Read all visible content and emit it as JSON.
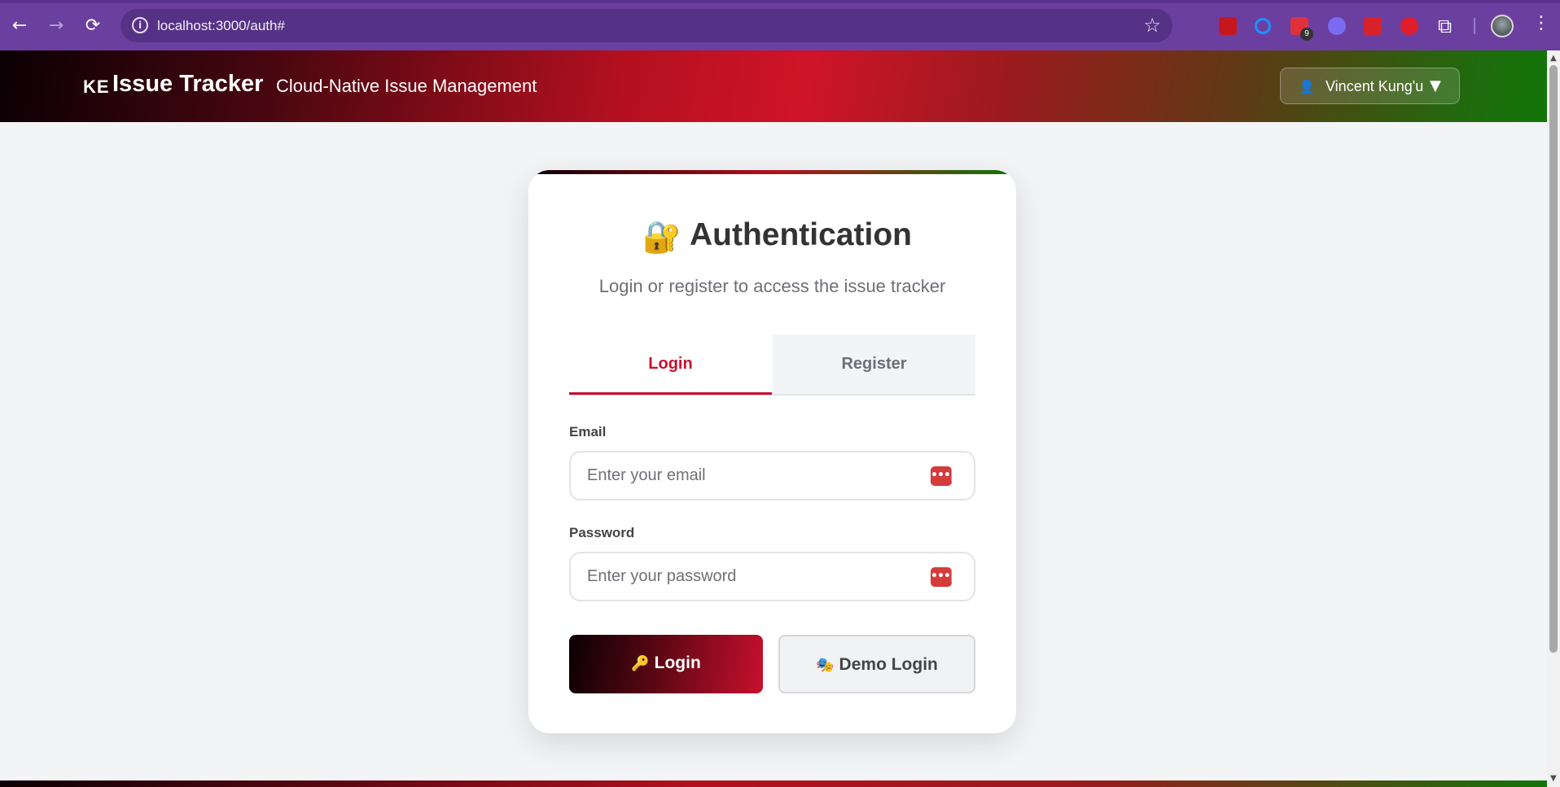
{
  "browser": {
    "url": "localhost:3000/auth#",
    "back_icon": "←",
    "forward_icon": "→",
    "reload_icon": "⟳",
    "info_icon": "i",
    "star_icon": "☆",
    "extensions_icon": "⧉",
    "menu_icon": "⋮",
    "extension_badge": "9"
  },
  "header": {
    "logo_text": "KE",
    "title": "Issue Tracker",
    "subtitle": "Cloud-Native Issue Management",
    "user_icon": "👤",
    "user_name": "Vincent Kung'u",
    "caret": "▼"
  },
  "card": {
    "lock_icon": "🔐",
    "title": "Authentication",
    "subtitle": "Login or register to access the issue tracker",
    "tabs": [
      {
        "label": "Login",
        "active": true
      },
      {
        "label": "Register",
        "active": false
      }
    ],
    "email": {
      "label": "Email",
      "placeholder": "Enter your email",
      "value": ""
    },
    "password": {
      "label": "Password",
      "placeholder": "Enter your password",
      "value": ""
    },
    "password_manager_icon": "•••|",
    "login_button": {
      "icon": "🔑",
      "label": "Login"
    },
    "demo_button": {
      "icon": "🎭",
      "label": "Demo Login"
    }
  },
  "colors": {
    "accent": "#c8102e",
    "browser_frame": "#6b3fa0",
    "header_start": "#0a0003",
    "header_mid": "#cf1428",
    "header_end": "#127508"
  }
}
